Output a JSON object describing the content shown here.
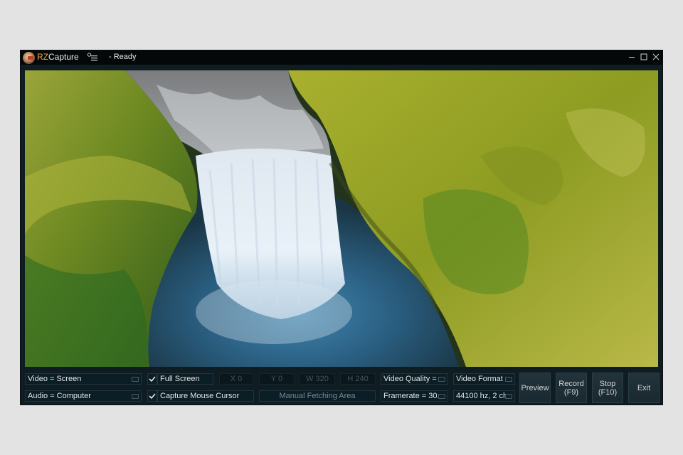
{
  "window": {
    "app_name_prefix": "RZ",
    "app_name_rest": "Capture",
    "status": "- Ready",
    "icons": {
      "logo": "app-logo-icon",
      "menu": "menu-list-icon",
      "minimize": "minimize-icon",
      "maximize": "maximize-icon",
      "close": "close-icon"
    }
  },
  "preview": {
    "description": "Aerial view of a waterfall between green mossy cliffs"
  },
  "controls": {
    "video_source": "Video = Screen",
    "audio_source": "Audio = Computer",
    "full_screen": {
      "label": "Full Screen",
      "checked": true
    },
    "capture_cursor": {
      "label": "Capture Mouse Cursor",
      "checked": true
    },
    "x": {
      "label": "X",
      "value": "0"
    },
    "y": {
      "label": "Y",
      "value": "0"
    },
    "w": {
      "label": "W",
      "value": "320"
    },
    "h": {
      "label": "H",
      "value": "240"
    },
    "manual_area": "Manual Fetching Area",
    "video_quality": "Video Quality = :",
    "video_format": "Video Format =",
    "framerate": "Framerate = 30.0",
    "audio_format": "44100 hz, 2 ch(",
    "buttons": {
      "preview": "Preview",
      "record": "Record\n(F9)",
      "stop": "Stop\n(F10)",
      "exit": "Exit"
    }
  },
  "colors": {
    "accent": "#f0a640",
    "window_bg": "#0f1c22",
    "titlebar_bg": "#040809"
  }
}
